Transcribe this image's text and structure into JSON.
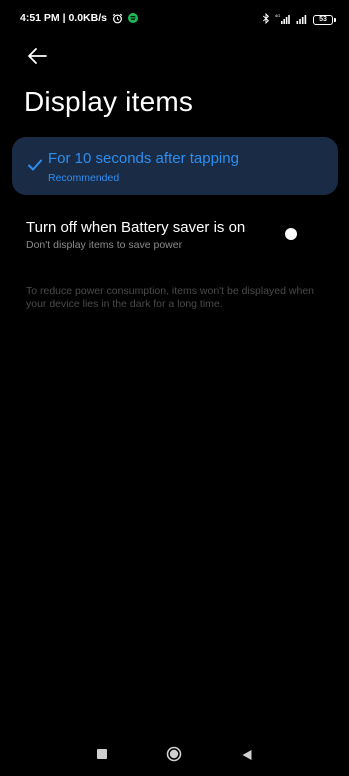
{
  "status_bar": {
    "time_and_speed": "4:51 PM | 0.0KB/s",
    "network_label": "4G",
    "battery_level": "53"
  },
  "header": {
    "title": "Display items"
  },
  "option": {
    "title": "For 10 seconds after tapping",
    "subtitle": "Recommended",
    "selected": true
  },
  "battery_saver": {
    "title": "Turn off when Battery saver is on",
    "subtitle": "Don't display items to save power",
    "enabled": false
  },
  "footnote": "To reduce power consumption, items won't be displayed when your device lies in the dark for a long time.",
  "colors": {
    "accent": "#2e8ef0",
    "card_background": "#1a2b45",
    "background": "#000000"
  },
  "icons": [
    "back-arrow-icon",
    "check-icon",
    "alarm-icon",
    "spotify-icon",
    "bluetooth-icon",
    "signal-icon",
    "battery-icon",
    "recents-icon",
    "home-icon",
    "nav-back-icon"
  ]
}
